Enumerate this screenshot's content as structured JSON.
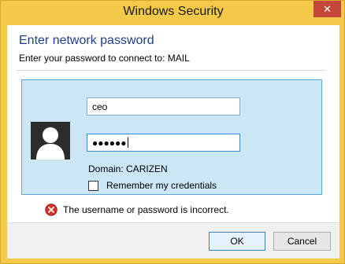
{
  "window": {
    "title": "Windows Security",
    "close_glyph": "✕"
  },
  "dialog": {
    "heading": "Enter network password",
    "subheading": "Enter your password to connect to: MAIL"
  },
  "credentials": {
    "username_value": "ceo",
    "password_mask": "●●●●●●",
    "domain_text": "Domain: CARIZEN",
    "remember_label": "Remember my credentials",
    "remember_checked": false,
    "avatar_icon": "user-silhouette-icon"
  },
  "error": {
    "icon": "error-circle-x-icon",
    "message": "The username or password is incorrect."
  },
  "buttons": {
    "ok_label": "OK",
    "cancel_label": "Cancel"
  },
  "colors": {
    "titlebar": "#f3c94a",
    "close_button": "#c7463a",
    "heading": "#1e3e8a",
    "tile_background": "#cbe6f5",
    "tile_border": "#5ba8d9",
    "error": "#d9342b"
  }
}
